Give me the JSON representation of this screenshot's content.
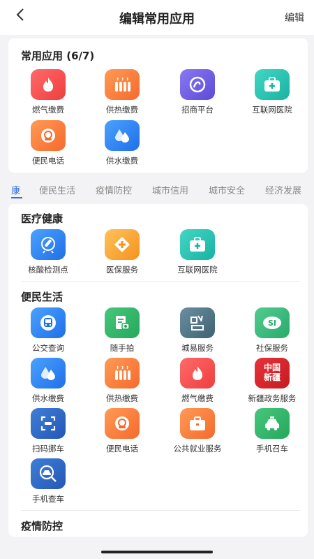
{
  "header": {
    "title": "编辑常用应用",
    "edit_label": "编辑",
    "back_icon": "chevron-left-icon"
  },
  "favorites": {
    "title": "常用应用 (6/7)",
    "apps": [
      {
        "label": "燃气缴费",
        "icon": "flame-icon"
      },
      {
        "label": "供热缴费",
        "icon": "radiator-icon"
      },
      {
        "label": "招商平台",
        "icon": "swirl-icon"
      },
      {
        "label": "互联网医院",
        "icon": "medical-kit-icon"
      },
      {
        "label": "便民电话",
        "icon": "phone-icon"
      },
      {
        "label": "供水缴费",
        "icon": "water-drop-icon"
      }
    ]
  },
  "tabs": [
    {
      "label": "康"
    },
    {
      "label": "便民生活"
    },
    {
      "label": "疫情防控"
    },
    {
      "label": "城市信用"
    },
    {
      "label": "城市安全"
    },
    {
      "label": "经济发展"
    }
  ],
  "sections": {
    "medical": {
      "title": "医疗健康",
      "apps": [
        {
          "label": "核酸检测点",
          "icon": "test-tube-icon"
        },
        {
          "label": "医保服务",
          "icon": "plus-cross-icon"
        },
        {
          "label": "互联网医院",
          "icon": "medical-kit-icon"
        }
      ]
    },
    "life": {
      "title": "便民生活",
      "apps": [
        {
          "label": "公交查询",
          "icon": "bus-icon"
        },
        {
          "label": "随手拍",
          "icon": "camera-doc-icon"
        },
        {
          "label": "城易服务",
          "icon": "city-service-icon"
        },
        {
          "label": "社保服务",
          "icon": "social-security-icon"
        },
        {
          "label": "供水缴费",
          "icon": "water-drop-icon"
        },
        {
          "label": "供热缴费",
          "icon": "radiator-icon"
        },
        {
          "label": "燃气缴费",
          "icon": "flame-icon"
        },
        {
          "label": "新疆政务服务",
          "icon": "xinjiang-gov-icon",
          "glyph": "中国\n新疆"
        },
        {
          "label": "扫码挪车",
          "icon": "scan-icon"
        },
        {
          "label": "便民电话",
          "icon": "phone-icon"
        },
        {
          "label": "公共就业服务",
          "icon": "briefcase-icon"
        },
        {
          "label": "手机召车",
          "icon": "taxi-icon"
        },
        {
          "label": "手机查车",
          "icon": "car-search-icon"
        }
      ]
    },
    "epidemic": {
      "title": "疫情防控"
    }
  },
  "colors": {
    "accent": "#2f6fe0",
    "background": "#f3f3f5"
  }
}
